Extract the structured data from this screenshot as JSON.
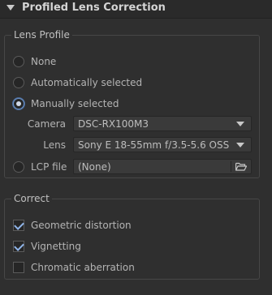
{
  "header": {
    "title": "Profiled Lens Correction"
  },
  "lens_profile": {
    "legend": "Lens Profile",
    "options": [
      {
        "label": "None",
        "selected": false
      },
      {
        "label": "Automatically selected",
        "selected": false
      },
      {
        "label": "Manually selected",
        "selected": true
      }
    ],
    "camera": {
      "label": "Camera",
      "value": "DSC-RX100M3"
    },
    "lens": {
      "label": "Lens",
      "value": "Sony E 18-55mm f/3.5-5.6 OSS"
    },
    "lcp": {
      "label": "LCP file",
      "value": "(None)",
      "selected": false
    }
  },
  "correct": {
    "legend": "Correct",
    "items": [
      {
        "label": "Geometric distortion",
        "checked": true
      },
      {
        "label": "Vignetting",
        "checked": true
      },
      {
        "label": "Chromatic aberration",
        "checked": false
      }
    ]
  }
}
